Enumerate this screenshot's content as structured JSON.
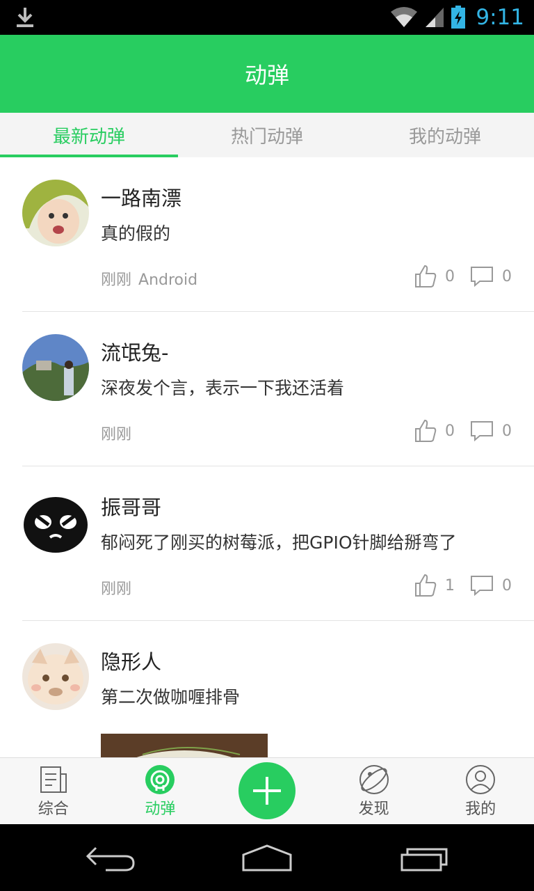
{
  "status_bar": {
    "time": "9:11"
  },
  "header": {
    "title": "动弹"
  },
  "tabs": [
    {
      "label": "最新动弹",
      "active": true
    },
    {
      "label": "热门动弹",
      "active": false
    },
    {
      "label": "我的动弹",
      "active": false
    }
  ],
  "posts": [
    {
      "author": "一路南漂",
      "content": "真的假的",
      "time": "刚刚",
      "source": "Android",
      "likes": "0",
      "comments": "0"
    },
    {
      "author": "流氓兔-",
      "content": "深夜发个言，表示一下我还活着",
      "time": "刚刚",
      "source": "",
      "likes": "0",
      "comments": "0"
    },
    {
      "author": "振哥哥",
      "content": "郁闷死了刚买的树莓派，把GPIO针脚给掰弯了",
      "time": "刚刚",
      "source": "",
      "likes": "1",
      "comments": "0"
    },
    {
      "author": "隐形人",
      "content": "第二次做咖喱排骨",
      "time": "",
      "source": "",
      "likes": "",
      "comments": ""
    }
  ],
  "bottom_nav": {
    "items": [
      {
        "label": "综合",
        "icon": "news-icon",
        "active": false
      },
      {
        "label": "动弹",
        "icon": "tweet-icon",
        "active": true
      },
      {
        "label": "发现",
        "icon": "planet-icon",
        "active": false
      },
      {
        "label": "我的",
        "icon": "user-icon",
        "active": false
      }
    ],
    "fab_icon": "plus-icon"
  },
  "colors": {
    "accent": "#28cd60",
    "status_icon": "#33b5e5"
  }
}
